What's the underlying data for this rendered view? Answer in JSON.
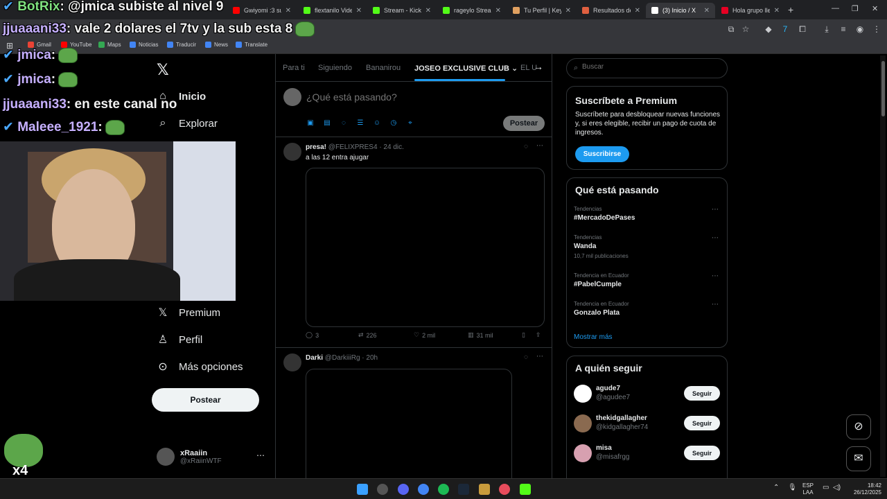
{
  "browser": {
    "tabs": [
      {
        "label": "Gwiyomi :3 su",
        "color": "#ff0000"
      },
      {
        "label": "flextanilo Vide",
        "color": "#53fc18"
      },
      {
        "label": "Stream - Kick",
        "color": "#53fc18"
      },
      {
        "label": "rageylo Stream",
        "color": "#53fc18"
      },
      {
        "label": "Tu Perfil | Key",
        "color": "#e0a060"
      },
      {
        "label": "Resultados de",
        "color": "#e06040"
      },
      {
        "label": "(3) Inicio / X",
        "color": "#ffffff",
        "active": true
      },
      {
        "label": "Hola grupo lle",
        "color": "#e60023"
      }
    ],
    "bookmarks": [
      "Gmail",
      "YouTube",
      "Maps",
      "Noticias",
      "Traducir",
      "News",
      "Translate"
    ]
  },
  "overlay": {
    "chat": [
      {
        "user": "BotRix",
        "text": ": @jmica subiste al nivel 9",
        "badge": true
      },
      {
        "user": "jjuaaani33",
        "text": ": vale 2 dolares el 7tv y la sub esta 8",
        "badge": false
      },
      {
        "user": "jmica",
        "text": ":",
        "badge": true
      },
      {
        "user": "jmica",
        "text": ":",
        "badge": true
      },
      {
        "user": "jjuaaani33",
        "text": ": en este canal no",
        "badge": false
      },
      {
        "user": "Maleee_1921",
        "text": ":",
        "badge": true
      }
    ],
    "multiplier": "x4"
  },
  "x": {
    "nav": [
      {
        "label": "Inicio",
        "icon": "home-icon",
        "glyph": "⌂"
      },
      {
        "label": "Explorar",
        "icon": "search-icon",
        "glyph": "⌕"
      },
      {
        "label": "Premium",
        "icon": "x-logo-icon",
        "glyph": "𝕏"
      },
      {
        "label": "Perfil",
        "icon": "user-icon",
        "glyph": "♙"
      },
      {
        "label": "Más opciones",
        "icon": "more-icon",
        "glyph": "⋯"
      }
    ],
    "post_button": "Postear",
    "account": {
      "name": "xRaaiin",
      "handle": "@xRaiinWTF"
    },
    "timeline_tabs": [
      "Para ti",
      "Siguiendo",
      "Bananirou",
      "JOSEO EXCLUSIVE CLUB",
      "EL U"
    ],
    "active_tab": "JOSEO EXCLUSIVE CLUB",
    "composer": {
      "placeholder": "¿Qué está pasando?",
      "post": "Postear"
    },
    "tweets": [
      {
        "name": "presa!",
        "handle": "@FELIXPRES4",
        "time": "· 24 dic.",
        "text": "a las 12 entra ajugar",
        "replies": "3",
        "retweets": "226",
        "likes": "2 mil",
        "views": "31 mil"
      },
      {
        "name": "Darki",
        "handle": "@DarkiiiRg",
        "time": "· 20h",
        "text": ""
      }
    ],
    "search_placeholder": "Buscar",
    "premium": {
      "title": "Suscríbete a Premium",
      "text": "Suscríbete para desbloquear nuevas funciones y, si eres elegible, recibir un pago de cuota de ingresos.",
      "button": "Suscribirse"
    },
    "trends_title": "Qué está pasando",
    "trends": [
      {
        "category": "Tendencias",
        "name": "#MercadoDePases",
        "count": ""
      },
      {
        "category": "Tendencias",
        "name": "Wanda",
        "count": "10,7 mil publicaciones"
      },
      {
        "category": "Tendencia en Ecuador",
        "name": "#PabelCumple",
        "count": ""
      },
      {
        "category": "Tendencia en Ecuador",
        "name": "Gonzalo Plata",
        "count": ""
      }
    ],
    "show_more": "Mostrar más",
    "who_title": "A quién seguir",
    "follow": [
      {
        "name": "agude7",
        "handle": "@agudee7",
        "button": "Seguir",
        "color": "#ffffff"
      },
      {
        "name": "thekidgallagher",
        "handle": "@kidgallagher74",
        "button": "Seguir",
        "color": "#8a6a50"
      },
      {
        "name": "misa",
        "handle": "@misafrgg",
        "button": "Seguir",
        "color": "#d7a0b0"
      }
    ]
  },
  "taskbar": {
    "lang": "ESP",
    "lang2": "LAA",
    "time": "18:42",
    "date": "26/12/2025"
  }
}
